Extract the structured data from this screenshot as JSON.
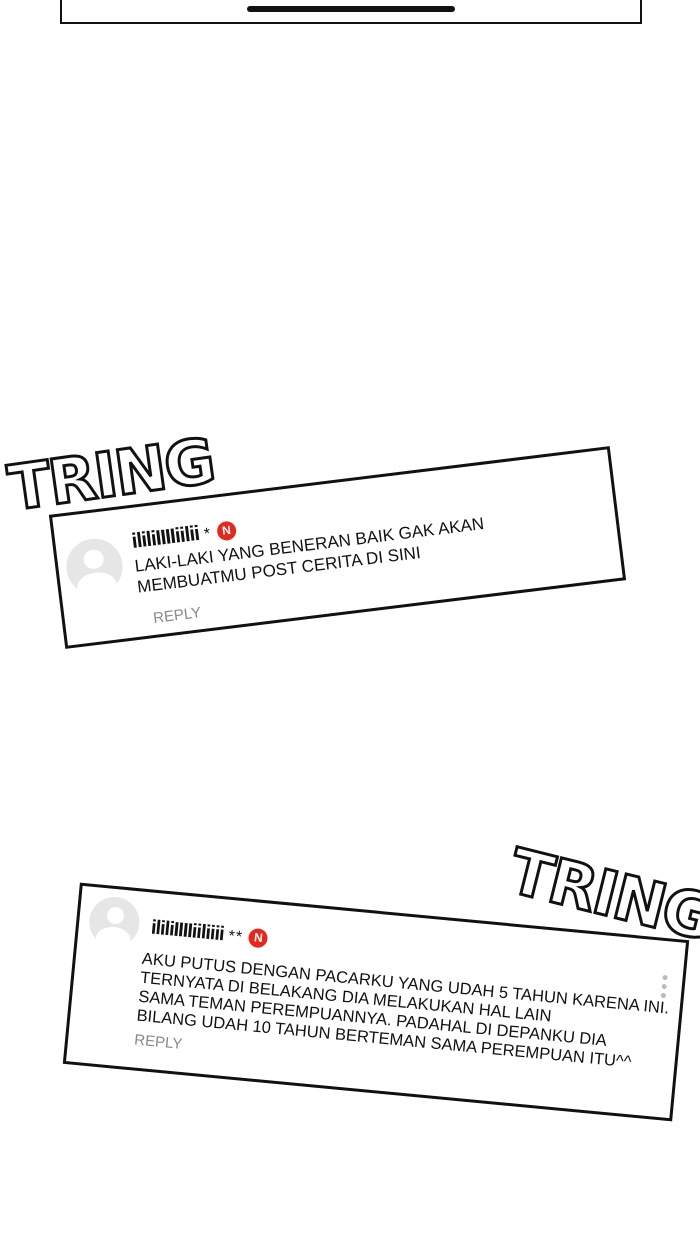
{
  "comments": [
    {
      "sfx": "TRING",
      "username": "ililiIIIIiilii",
      "suffix": "*",
      "badge": "N",
      "text": "LAKI-LAKI YANG BENERAN BAIK GAK AKAN\nMEMBUATMU POST CERITA DI SINI",
      "reply_label": "REPLY"
    },
    {
      "sfx": "TRING",
      "username": "ililiIIIIiiliiii",
      "suffix": "**",
      "badge": "N",
      "text": "AKU PUTUS DENGAN PACARKU YANG UDAH 5 TAHUN KARENA INI.\nTERNYATA DI BELAKANG DIA MELAKUKAN HAL LAIN\nSAMA TEMAN PEREMPUANNYA. PADAHAL DI DEPANKU DIA\nBILANG UDAH 10 TAHUN BERTEMAN SAMA PEREMPUAN ITU^^",
      "reply_label": "REPLY"
    }
  ],
  "colors": {
    "badge": "#e8261b",
    "reply": "#888888"
  }
}
